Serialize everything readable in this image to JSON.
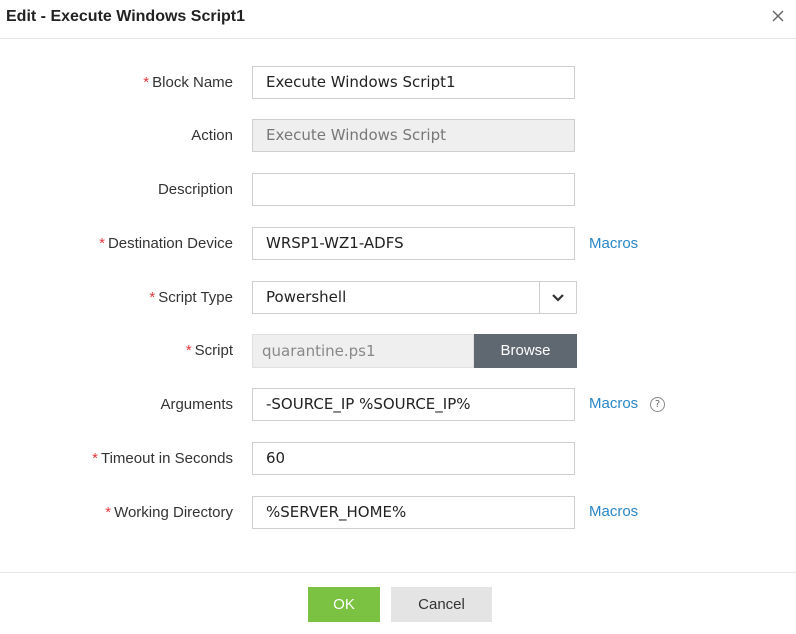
{
  "dialog": {
    "title": "Edit - Execute Windows Script1",
    "close_icon": "close-icon"
  },
  "form": {
    "block_name": {
      "label": "Block Name",
      "required": true,
      "value": "Execute Windows Script1"
    },
    "action": {
      "label": "Action",
      "required": false,
      "value": "Execute Windows Script",
      "disabled": true
    },
    "description": {
      "label": "Description",
      "required": false,
      "value": ""
    },
    "destination_device": {
      "label": "Destination Device",
      "required": true,
      "value": "WRSP1-WZ1-ADFS",
      "link": "Macros"
    },
    "script_type": {
      "label": "Script Type",
      "required": true,
      "value": "Powershell",
      "icon": "chevron-down-icon"
    },
    "script": {
      "label": "Script",
      "required": true,
      "value": "quarantine.ps1",
      "button": "Browse"
    },
    "arguments": {
      "label": "Arguments",
      "required": false,
      "value": "-SOURCE_IP %SOURCE_IP%",
      "link": "Macros",
      "help_icon": "help-icon",
      "help_glyph": "?"
    },
    "timeout": {
      "label": "Timeout in Seconds",
      "required": true,
      "value": "60"
    },
    "working_directory": {
      "label": "Working Directory",
      "required": true,
      "value": "%SERVER_HOME%",
      "link": "Macros"
    }
  },
  "footer": {
    "ok_label": "OK",
    "cancel_label": "Cancel"
  },
  "colors": {
    "required_marker": "#e0393e",
    "link": "#2a86c6",
    "ok_button": "#7cc242",
    "browse_button": "#5f6870"
  },
  "required_marker": "*"
}
